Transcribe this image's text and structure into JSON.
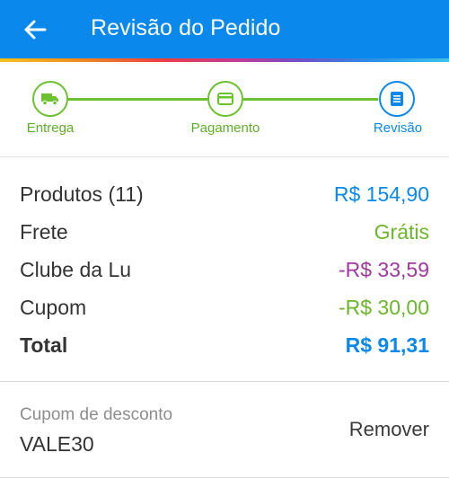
{
  "header": {
    "title": "Revisão do Pedido",
    "back_icon": "arrow-left-icon",
    "background": "#0a88ec"
  },
  "stepper": {
    "steps": [
      {
        "label": "Entrega",
        "icon": "truck-icon",
        "status": "completed"
      },
      {
        "label": "Pagamento",
        "icon": "credit-card-icon",
        "status": "completed"
      },
      {
        "label": "Revisão",
        "icon": "document-icon",
        "status": "current"
      }
    ],
    "colors": {
      "completed": "#6cc12e",
      "current": "#0a88ec"
    }
  },
  "summary": {
    "rows": [
      {
        "label": "Produtos (11)",
        "value": "R$ 154,90",
        "color": "#0a88ec"
      },
      {
        "label": "Frete",
        "value": "Grátis",
        "color": "#6cb62b"
      },
      {
        "label": "Clube da Lu",
        "value": "-R$ 33,59",
        "color": "#a0399b"
      },
      {
        "label": "Cupom",
        "value": "-R$ 30,00",
        "color": "#6cb62b"
      },
      {
        "label": "Total",
        "value": "R$ 91,31",
        "color": "#0a88ec"
      }
    ]
  },
  "coupon": {
    "label": "Cupom de desconto",
    "code": "VALE30",
    "remove_label": "Remover"
  }
}
